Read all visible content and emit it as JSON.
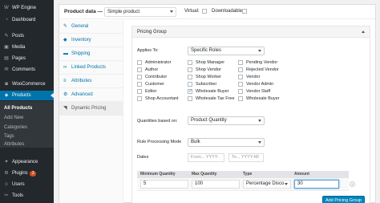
{
  "sidebar": {
    "items": [
      {
        "icon": "wordpress-icon",
        "glyph": "W",
        "label": "WP Engine"
      },
      {
        "icon": "dashboard-icon",
        "glyph": "◔",
        "label": "Dashboard"
      },
      {
        "icon": "pin-icon",
        "glyph": "✎",
        "label": "Posts"
      },
      {
        "icon": "media-icon",
        "glyph": "▣",
        "label": "Media"
      },
      {
        "icon": "pages-icon",
        "glyph": "▤",
        "label": "Pages"
      },
      {
        "icon": "comments-icon",
        "glyph": "✉",
        "label": "Comments"
      },
      {
        "icon": "woocommerce-icon",
        "glyph": "◙",
        "label": "WooCommerce"
      },
      {
        "icon": "products-icon",
        "glyph": "◈",
        "label": "Products"
      }
    ],
    "submenu": [
      "All Products",
      "Add New",
      "Categories",
      "Tags",
      "Attributes"
    ],
    "bottom_items": [
      {
        "icon": "appearance-icon",
        "glyph": "✦",
        "label": "Appearance"
      },
      {
        "icon": "plugins-icon",
        "glyph": "⚙",
        "label": "Plugins",
        "badge": "3"
      },
      {
        "icon": "users-icon",
        "glyph": "☺",
        "label": "Users"
      },
      {
        "icon": "tools-icon",
        "glyph": "✂",
        "label": "Tools"
      }
    ],
    "colors": {
      "bg": "#23282d",
      "active": "#0073aa",
      "badge": "#d54e21"
    }
  },
  "product_data": {
    "title": "Product data —",
    "type_select": "Simple product",
    "virtual_label": "Virtual:",
    "downloadable_label": "Downloadable:"
  },
  "tabs": [
    {
      "icon": "wrench-icon",
      "glyph": "✎",
      "label": "General"
    },
    {
      "icon": "inventory-icon",
      "glyph": "◆",
      "label": "Inventory"
    },
    {
      "icon": "truck-icon",
      "glyph": "▬",
      "label": "Shipping"
    },
    {
      "icon": "link-icon",
      "glyph": "∞",
      "label": "Linked Products"
    },
    {
      "icon": "list-icon",
      "glyph": "≡",
      "label": "Attributes"
    },
    {
      "icon": "gear-icon",
      "glyph": "⚙",
      "label": "Advanced"
    },
    {
      "icon": "tag-icon",
      "glyph": "◥",
      "label": "Dynamic Pricing"
    }
  ],
  "pricing_group": {
    "title": "Pricing Group",
    "applies_to_label": "Applies To:",
    "applies_to_value": "Specific Roles",
    "roles": [
      {
        "label": "Administrator",
        "checked": false
      },
      {
        "label": "Author",
        "checked": false
      },
      {
        "label": "Contributor",
        "checked": false
      },
      {
        "label": "Customer",
        "checked": false
      },
      {
        "label": "Editor",
        "checked": false
      },
      {
        "label": "Shop Accountant",
        "checked": false
      },
      {
        "label": "Shop Manager",
        "checked": false
      },
      {
        "label": "Shop Vendor",
        "checked": false
      },
      {
        "label": "Shop Worker",
        "checked": false
      },
      {
        "label": "Subscriber",
        "checked": false
      },
      {
        "label": "Wholesale Buyer",
        "checked": true
      },
      {
        "label": "Wholesale Tax Free",
        "checked": false
      },
      {
        "label": "Pending Vendor",
        "checked": false
      },
      {
        "label": "Rejected Vendor",
        "checked": false
      },
      {
        "label": "Vendor",
        "checked": false
      },
      {
        "label": "Vendor Admin",
        "checked": false
      },
      {
        "label": "Vendor Staff",
        "checked": false
      },
      {
        "label": "Wholesale Buyer",
        "checked": false
      }
    ],
    "quantities_label": "Quantities based on:",
    "quantities_value": "Product Quantity",
    "rule_mode_label": "Rule Processing Mode",
    "rule_mode_value": "Bulk",
    "dates_label": "Dates",
    "date_from_placeholder": "From... YYYY-",
    "date_to_placeholder": "To... YYYY-MI",
    "table": {
      "headers": [
        "Minimum Quantity",
        "Max Quantity",
        "Type",
        "Amount"
      ],
      "row": {
        "min": "5",
        "max": "100",
        "type": "Percentage Disco",
        "amount": "30"
      }
    },
    "add_button": "Add Pricing Group"
  }
}
